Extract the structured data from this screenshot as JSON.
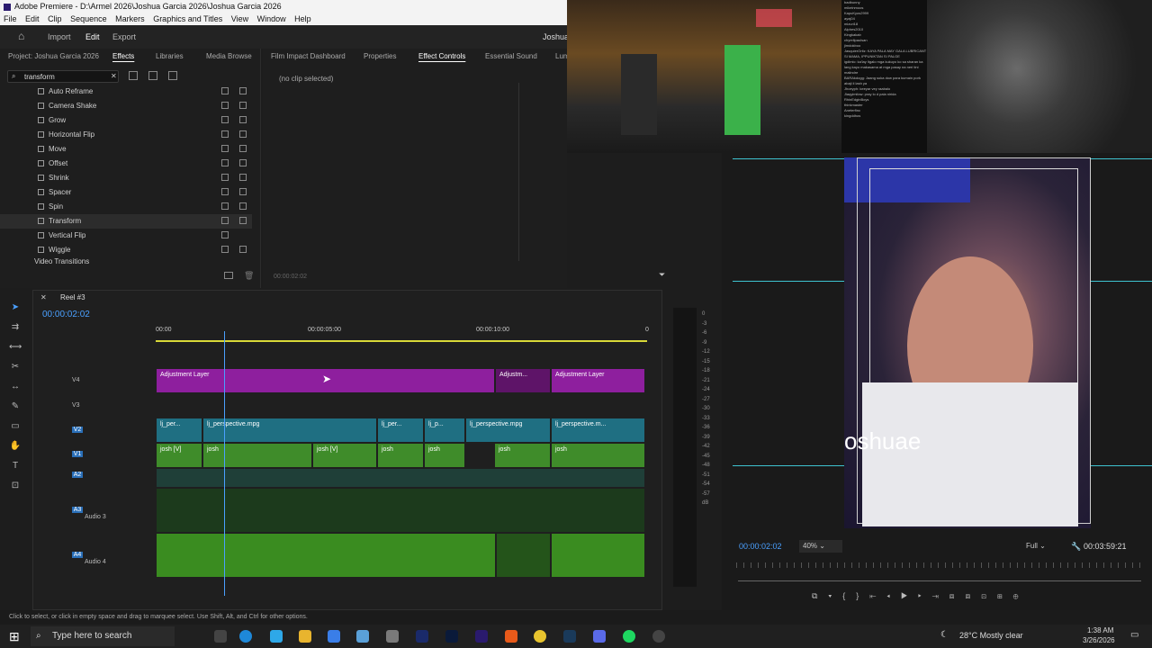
{
  "window": {
    "title": "Adobe Premiere - D:\\Armel 2026\\Joshua Garcia 2026\\Joshua Garcia 2026"
  },
  "menu": [
    "File",
    "Edit",
    "Clip",
    "Sequence",
    "Markers",
    "Graphics and Titles",
    "View",
    "Window",
    "Help"
  ],
  "workspace": {
    "tabs": [
      "Import",
      "Edit",
      "Export"
    ],
    "active": "Edit",
    "project_label": "Joshua"
  },
  "left_panel": {
    "tabs": [
      "Project: Joshua Garcia 2026",
      "Effects",
      "Libraries",
      "Media Browse"
    ],
    "active_tab": "Effects",
    "search_value": "transform",
    "effects": [
      {
        "label": "Auto Reframe"
      },
      {
        "label": "Camera Shake"
      },
      {
        "label": "Grow"
      },
      {
        "label": "Horizontal Flip"
      },
      {
        "label": "Move"
      },
      {
        "label": "Offset"
      },
      {
        "label": "Shrink"
      },
      {
        "label": "Spacer"
      },
      {
        "label": "Spin"
      },
      {
        "label": "Transform"
      },
      {
        "label": "Vertical Flip"
      },
      {
        "label": "Wiggle"
      },
      {
        "label": "Video Transitions"
      }
    ],
    "selected": "Transform"
  },
  "effect_controls": {
    "tabs": [
      "Film Impact Dashboard",
      "Properties",
      "Effect Controls",
      "Essential Sound",
      "Lum"
    ],
    "active_tab": "Effect Controls",
    "no_clip": "(no clip selected)",
    "timecode": "00:00:02:02"
  },
  "chat": {
    "lines": [
      "badbunny",
      "mikeinmoos",
      "KapuKyos2999",
      "ayaj04",
      "mizuri18",
      "Alphes2010",
      "Kingkakab",
      "chyrellpaulsan",
      "jimdokboo",
      "JasquierOrtiz: KAYA PALA MAY GALA LUBRICANT SI MAMA, IPPUNIKTAN SI PALGE",
      "igdimic: ka'lay ltgalo mga kukuyo ko sa sharan ka lang kayo makasama at mga pasay na neri tini malindre",
      "BARAkdogg: Jaang suka dow para kumain pork abaji ii lash ya",
      "Jhoeyph: keeyar vey raabalo",
      "Jiaqyimilow: pray lo d pala nirida",
      "RhinEdginBoys",
      "thinkmaster",
      "Aneterfinc",
      "kingddhos"
    ]
  },
  "program_monitor": {
    "current_time": "00:00:02:02",
    "zoom": "40%",
    "resolution": "Full",
    "duration": "00:03:59:21",
    "overlay_text": "oshuae"
  },
  "timeline": {
    "sequence": "Reel #3",
    "timecode": "00:00:02:02",
    "ruler": [
      "00:00",
      "00:00:05:00",
      "00:00:10:00",
      "0"
    ],
    "tracks": [
      {
        "name": "V4",
        "label": ""
      },
      {
        "name": "V3",
        "label": ""
      },
      {
        "name": "V2",
        "label": ""
      },
      {
        "name": "V1",
        "label": ""
      },
      {
        "name": "A2",
        "label": ""
      },
      {
        "name": "A3",
        "label": "Audio 3"
      },
      {
        "name": "A4",
        "label": "Audio 4"
      }
    ],
    "v4_clips": [
      "Adjustment Layer",
      "Adjustm...",
      "Adjustment Layer"
    ],
    "v2_clips": [
      "lj_per...",
      "lj_perspective.mpg",
      "lj_per...",
      "lj_p...",
      "lj_perspective.mpg",
      "lj_perspective.m..."
    ],
    "v1_clips": [
      "josh [V]",
      "josh",
      "josh [V]",
      "josh",
      "josh",
      "josh",
      "josh"
    ]
  },
  "meters": {
    "scale": [
      "0",
      "-3",
      "-6",
      "-9",
      "-12",
      "-15",
      "-18",
      "-21",
      "-24",
      "-27",
      "-30",
      "-33",
      "-36",
      "-39",
      "-42",
      "-45",
      "-48",
      "-51",
      "-54",
      "-57",
      "dB"
    ]
  },
  "status_bar": "Click to select, or click in empty space and drag to marquee select. Use Shift, Alt, and Ctrl for other options.",
  "taskbar": {
    "search_placeholder": "Type here to search",
    "weather": "28°C  Mostly clear",
    "time": "1:38 AM",
    "date": "3/26/2026"
  }
}
